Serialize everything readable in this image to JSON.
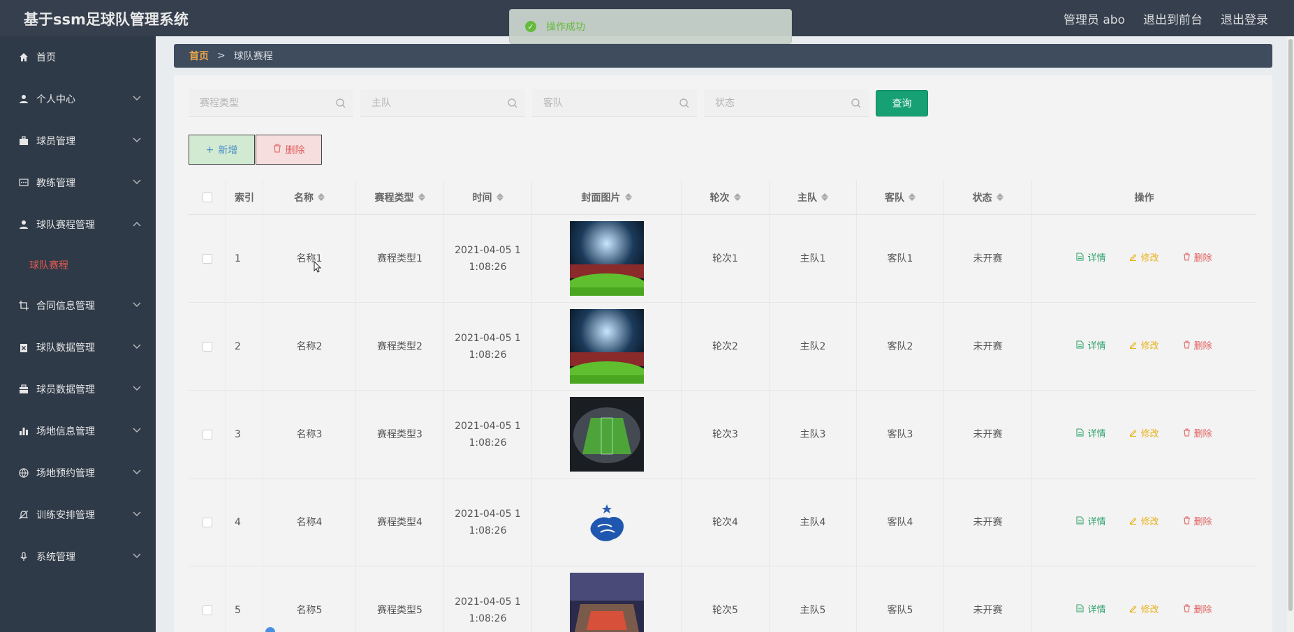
{
  "app": {
    "title": "基于ssm足球队管理系统"
  },
  "top_links": {
    "user": "管理员 abo",
    "front": "退出到前台",
    "logout": "退出登录"
  },
  "toast": {
    "message": "操作成功"
  },
  "sidebar": {
    "items": [
      {
        "label": "首页",
        "icon": "home-icon",
        "expandable": false
      },
      {
        "label": "个人中心",
        "icon": "user-icon",
        "expandable": true
      },
      {
        "label": "球员管理",
        "icon": "briefcase-icon",
        "expandable": true
      },
      {
        "label": "教练管理",
        "icon": "chat-icon",
        "expandable": true
      },
      {
        "label": "球队赛程管理",
        "icon": "person-icon",
        "expandable": true,
        "expanded": true
      },
      {
        "label": "合同信息管理",
        "icon": "crop-icon",
        "expandable": true
      },
      {
        "label": "球队数据管理",
        "icon": "clipboard-icon",
        "expandable": true
      },
      {
        "label": "球员数据管理",
        "icon": "toolbox-icon",
        "expandable": true
      },
      {
        "label": "场地信息管理",
        "icon": "bar-chart-icon",
        "expandable": true
      },
      {
        "label": "场地预约管理",
        "icon": "globe-icon",
        "expandable": true
      },
      {
        "label": "训练安排管理",
        "icon": "bell-off-icon",
        "expandable": true
      },
      {
        "label": "系统管理",
        "icon": "mic-icon",
        "expandable": true
      }
    ],
    "active_sub": "球队赛程"
  },
  "breadcrumb": {
    "home": "首页",
    "separator": ">",
    "current": "球队赛程"
  },
  "search": {
    "type_placeholder": "赛程类型",
    "home_placeholder": "主队",
    "away_placeholder": "客队",
    "status_placeholder": "状态",
    "query_label": "查询"
  },
  "actions": {
    "add_label": "新增",
    "delete_label": "删除"
  },
  "table": {
    "headers": [
      "索引",
      "名称",
      "赛程类型",
      "时间",
      "封面图片",
      "轮次",
      "主队",
      "客队",
      "状态",
      "操作"
    ],
    "op_labels": {
      "view": "详情",
      "edit": "修改",
      "delete": "删除"
    },
    "rows": [
      {
        "index": "1",
        "name": "名称1",
        "type": "赛程类型1",
        "time": "2021-04-05 11:08:26",
        "round": "轮次1",
        "home": "主队1",
        "away": "客队1",
        "status": "未开赛",
        "cover": "stadium-lights"
      },
      {
        "index": "2",
        "name": "名称2",
        "type": "赛程类型2",
        "time": "2021-04-05 11:08:26",
        "round": "轮次2",
        "home": "主队2",
        "away": "客队2",
        "status": "未开赛",
        "cover": "stadium-lights"
      },
      {
        "index": "3",
        "name": "名称3",
        "type": "赛程类型3",
        "time": "2021-04-05 11:08:26",
        "round": "轮次3",
        "home": "主队3",
        "away": "客队3",
        "status": "未开赛",
        "cover": "stadium-aerial"
      },
      {
        "index": "4",
        "name": "名称4",
        "type": "赛程类型4",
        "time": "2021-04-05 11:08:26",
        "round": "轮次4",
        "home": "主队4",
        "away": "客队4",
        "status": "未开赛",
        "cover": "rooster-logo"
      },
      {
        "index": "5",
        "name": "名称5",
        "type": "赛程类型5",
        "time": "2021-04-05 11:08:26",
        "round": "轮次5",
        "home": "主队5",
        "away": "客队5",
        "status": "未开赛",
        "cover": "stadium-night"
      }
    ]
  },
  "colors": {
    "topbar": "#353f4e",
    "sidebar": "#2f3a48",
    "accent": "#16a074",
    "active": "#e65a4f",
    "view": "#2fa36b",
    "edit": "#e8b21d",
    "delete": "#e06060"
  }
}
